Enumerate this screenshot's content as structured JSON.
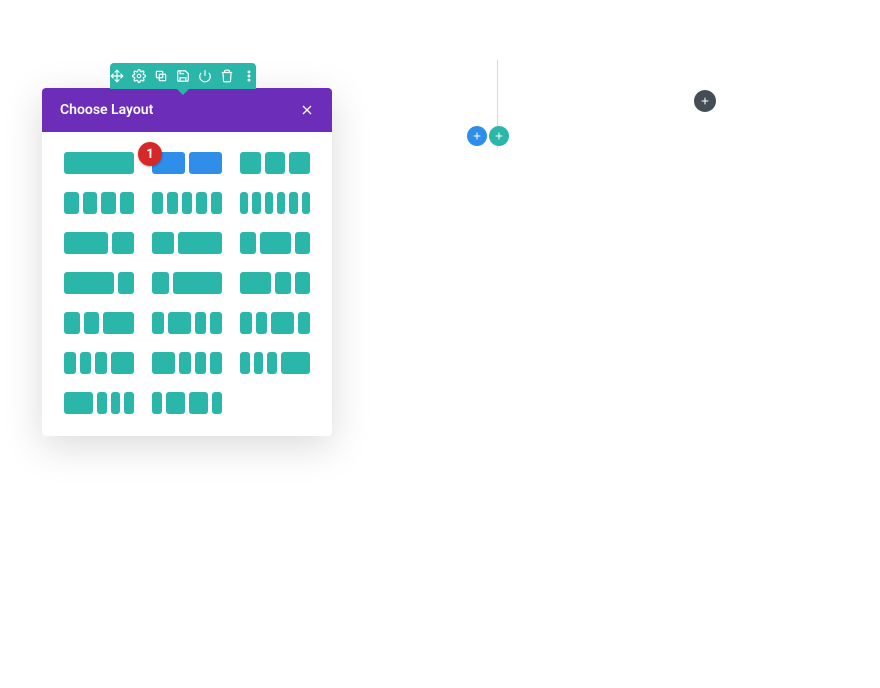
{
  "toolbar": {
    "icons": [
      "move",
      "settings",
      "duplicate",
      "save",
      "power",
      "delete",
      "more"
    ]
  },
  "modal": {
    "title": "Choose Layout",
    "step_badge": "1",
    "layouts": [
      {
        "cols": [
          1
        ],
        "highlight": false
      },
      {
        "cols": [
          1,
          1
        ],
        "highlight": true
      },
      {
        "cols": [
          1,
          1,
          1
        ],
        "highlight": false
      },
      {
        "cols": [
          1,
          1,
          1,
          1
        ],
        "highlight": false
      },
      {
        "cols": [
          1,
          1,
          1,
          1,
          1
        ],
        "highlight": false
      },
      {
        "cols": [
          1,
          1,
          1,
          1,
          1,
          1
        ],
        "highlight": false
      },
      {
        "cols": [
          2,
          1
        ],
        "highlight": false
      },
      {
        "cols": [
          1,
          2
        ],
        "highlight": false
      },
      {
        "cols": [
          1,
          2,
          1
        ],
        "highlight": false
      },
      {
        "cols": [
          3,
          1
        ],
        "highlight": false
      },
      {
        "cols": [
          1,
          3
        ],
        "highlight": false
      },
      {
        "cols": [
          2,
          1,
          1
        ],
        "highlight": false
      },
      {
        "cols": [
          1,
          1,
          2
        ],
        "highlight": false
      },
      {
        "cols": [
          1,
          2,
          1,
          1
        ],
        "highlight": false
      },
      {
        "cols": [
          1,
          1,
          2,
          1
        ],
        "highlight": false
      },
      {
        "cols": [
          1,
          1,
          1,
          2
        ],
        "highlight": false
      },
      {
        "cols": [
          2,
          1,
          1,
          1
        ],
        "highlight": false
      },
      {
        "cols": [
          1,
          1,
          1,
          3
        ],
        "highlight": false
      },
      {
        "cols": [
          3,
          1,
          1,
          1
        ],
        "highlight": false
      },
      {
        "cols": [
          1,
          2,
          2,
          1
        ],
        "highlight": false
      }
    ]
  },
  "buttons": {
    "add_section": "+",
    "add_row": "+",
    "add_new": "+"
  }
}
